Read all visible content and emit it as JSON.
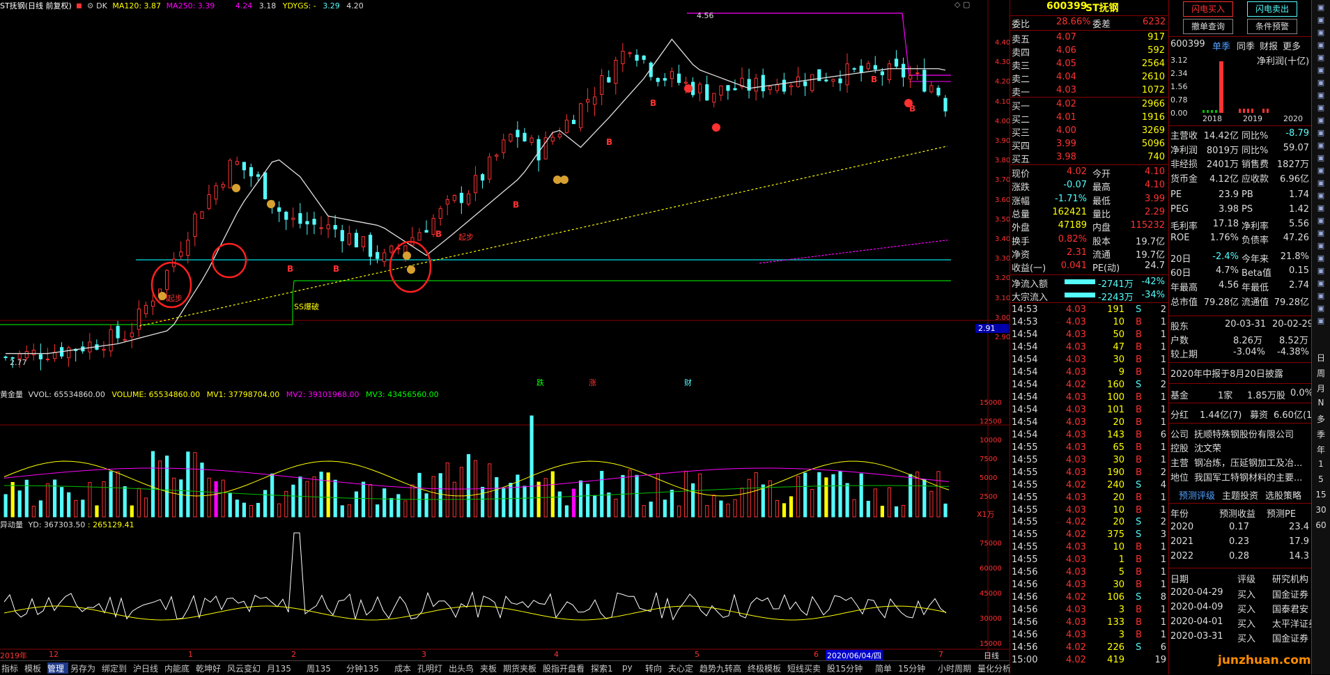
{
  "colors": {
    "up": "#ff3232",
    "down": "#54fcfc",
    "ma": "#e0e0e0",
    "yellow": "#ffff00",
    "magenta": "#ff00ff",
    "cyanline": "#00e0e0",
    "greenline": "#00d000"
  },
  "main_header": {
    "title": "ST抚钢(日线 前复权)",
    "dk": "DK",
    "ma120": "MA120: 3.87",
    "ma250": "MA250: 3.39",
    "v1": "4.24",
    "v2": "3.18",
    "ydygs": "YDYGS: -",
    "v3": "3.29",
    "v4": "4.20"
  },
  "price_axis": [
    "4.40",
    "4.30",
    "4.20",
    "4.10",
    "4.00",
    "3.90",
    "3.80",
    "3.70",
    "3.60",
    "3.50",
    "3.40",
    "3.30",
    "3.20",
    "3.10",
    "3.00",
    "2.90"
  ],
  "price_tag": "2.91",
  "annotations": {
    "high": "4.56",
    "low": "2.77",
    "qibu1": "起步",
    "qibu2": "起步",
    "baopo": "SS爆破",
    "die": "跌",
    "zhang": "涨",
    "cai": "财",
    "b": "B"
  },
  "vol_header": {
    "name": "黄金量",
    "vvol": "VVOL: 65534860.00",
    "volume": "VOLUME: 65534860.00",
    "mv1": "MV1: 37798704.00",
    "mv2": "MV2: 39101968.00",
    "mv3": "MV3: 43456560.00"
  },
  "vol_axis": [
    "15000",
    "12500",
    "10000",
    "7500",
    "5000",
    "2500"
  ],
  "vol_unit": "X1万",
  "yd_header": {
    "name": "异动量",
    "yd": "YD: 367303.50",
    "v2": ": 265129.41"
  },
  "yd_axis": [
    "75000",
    "60000",
    "45000",
    "30000",
    "15000"
  ],
  "date_axis": {
    "left": "2019年",
    "m12": "12",
    "m1": "1",
    "m2": "2",
    "m3": "3",
    "m4": "4",
    "m5": "5",
    "m6": "6",
    "cursor_date": "2020/06/04/四",
    "m7": "7",
    "period": "日线"
  },
  "bottom_tabs": [
    "指标",
    "模板",
    "管理",
    "另存为",
    "绑定到",
    "沪日线",
    "内能底",
    "乾坤好",
    "风云变幻",
    "月135",
    "周135",
    "分钟135",
    "成本",
    "孔明灯",
    "出头鸟",
    "夹板",
    "期货夹板",
    "股指开盘看",
    "探索1",
    "py",
    "转向",
    "夫心定",
    "趋势九转高",
    "终极模板",
    "短线买卖",
    "股15分钟",
    "简单",
    "15分钟",
    "小时周期",
    "量化分析"
  ],
  "quote": {
    "code": "600399",
    "name": "ST抚钢",
    "weibi_label": "委比",
    "weibi": "28.66%",
    "weicha_label": "委差",
    "weicha": "6232",
    "sells": [
      {
        "label": "卖五",
        "price": "4.07",
        "vol": "917"
      },
      {
        "label": "卖四",
        "price": "4.06",
        "vol": "592"
      },
      {
        "label": "卖三",
        "price": "4.05",
        "vol": "2564"
      },
      {
        "label": "卖二",
        "price": "4.04",
        "vol": "2610"
      },
      {
        "label": "卖一",
        "price": "4.03",
        "vol": "1072"
      }
    ],
    "buys": [
      {
        "label": "买一",
        "price": "4.02",
        "vol": "2966"
      },
      {
        "label": "买二",
        "price": "4.01",
        "vol": "1916"
      },
      {
        "label": "买三",
        "price": "4.00",
        "vol": "3269"
      },
      {
        "label": "买四",
        "price": "3.99",
        "vol": "5096"
      },
      {
        "label": "买五",
        "price": "3.98",
        "vol": "740"
      }
    ],
    "stats": [
      {
        "l1": "现价",
        "v1": "4.02",
        "l2": "今开",
        "v2": "4.10"
      },
      {
        "l1": "涨跌",
        "v1": "-0.07",
        "l2": "最高",
        "v2": "4.10"
      },
      {
        "l1": "涨幅",
        "v1": "-1.71%",
        "l2": "最低",
        "v2": "3.99"
      },
      {
        "l1": "总量",
        "v1": "162421",
        "l2": "量比",
        "v2": "2.29"
      },
      {
        "l1": "外盘",
        "v1": "47189",
        "l2": "内盘",
        "v2": "115232"
      },
      {
        "l1": "换手",
        "v1": "0.82%",
        "l2": "股本",
        "v2": "19.7亿"
      },
      {
        "l1": "净资",
        "v1": "2.31",
        "l2": "流通",
        "v2": "19.7亿"
      },
      {
        "l1": "收益(一)",
        "v1": "0.041",
        "l2": "PE(动)",
        "v2": "24.7"
      }
    ],
    "flows": [
      {
        "label": "净流入额",
        "value": "-2741万",
        "pct": "-42%"
      },
      {
        "label": "大宗流入",
        "value": "-2243万",
        "pct": "-34%"
      }
    ],
    "ticks": [
      [
        "14:53",
        "4.03",
        "191",
        "S",
        "2"
      ],
      [
        "14:53",
        "4.03",
        "10",
        "B",
        "1"
      ],
      [
        "14:54",
        "4.03",
        "50",
        "B",
        "1"
      ],
      [
        "14:54",
        "4.03",
        "47",
        "B",
        "1"
      ],
      [
        "14:54",
        "4.03",
        "30",
        "B",
        "1"
      ],
      [
        "14:54",
        "4.03",
        "9",
        "B",
        "1"
      ],
      [
        "14:54",
        "4.02",
        "160",
        "S",
        "2"
      ],
      [
        "14:54",
        "4.03",
        "100",
        "B",
        "1"
      ],
      [
        "14:54",
        "4.03",
        "101",
        "B",
        "1"
      ],
      [
        "14:54",
        "4.03",
        "20",
        "B",
        "1"
      ],
      [
        "14:54",
        "4.03",
        "143",
        "B",
        "6"
      ],
      [
        "14:55",
        "4.03",
        "65",
        "B",
        "1"
      ],
      [
        "14:55",
        "4.03",
        "30",
        "B",
        "1"
      ],
      [
        "14:55",
        "4.03",
        "190",
        "B",
        "2"
      ],
      [
        "14:55",
        "4.02",
        "240",
        "S",
        "4"
      ],
      [
        "14:55",
        "4.03",
        "20",
        "B",
        "1"
      ],
      [
        "14:55",
        "4.03",
        "10",
        "B",
        "1"
      ],
      [
        "14:55",
        "4.02",
        "20",
        "S",
        "2"
      ],
      [
        "14:55",
        "4.02",
        "375",
        "S",
        "3"
      ],
      [
        "14:55",
        "4.03",
        "10",
        "B",
        "1"
      ],
      [
        "14:55",
        "4.03",
        "1",
        "B",
        "1"
      ],
      [
        "14:56",
        "4.03",
        "5",
        "B",
        "1"
      ],
      [
        "14:56",
        "4.03",
        "30",
        "B",
        "1"
      ],
      [
        "14:56",
        "4.02",
        "106",
        "S",
        "8"
      ],
      [
        "14:56",
        "4.03",
        "3",
        "B",
        "1"
      ],
      [
        "14:56",
        "4.03",
        "133",
        "B",
        "1"
      ],
      [
        "14:56",
        "4.03",
        "3",
        "B",
        "1"
      ],
      [
        "14:56",
        "4.02",
        "226",
        "S",
        "6"
      ],
      [
        "15:00",
        "4.02",
        "419",
        "",
        "19"
      ]
    ]
  },
  "f10": {
    "btn_buy": "闪电买入",
    "btn_sell": "闪电卖出",
    "btn_cancel": "撤单查询",
    "btn_cond": "条件预警",
    "code": "600399",
    "tab1": "单季",
    "tab2": "同季",
    "tab3": "财报",
    "tab4": "更多",
    "chart_title": "净利润(十亿)",
    "chart_data": {
      "type": "bar",
      "categories": [
        "2018",
        "2019",
        "2020"
      ],
      "yticks": [
        "3.12",
        "2.34",
        "1.56",
        "0.78",
        "0.00"
      ]
    },
    "fin": [
      {
        "l1": "主营收",
        "v1": "14.42亿",
        "l2": "同比%",
        "v2": "-8.79"
      },
      {
        "l1": "净利润",
        "v1": "8019万",
        "l2": "同比%",
        "v2": "59.07"
      },
      {
        "l1": "非经损",
        "v1": "2401万",
        "l2": "销售费",
        "v2": "1827万"
      },
      {
        "l1": "货币金",
        "v1": "4.12亿",
        "l2": "应收款",
        "v2": "6.96亿"
      },
      {
        "l1": "PE",
        "v1": "23.9",
        "l2": "PB",
        "v2": "1.74"
      },
      {
        "l1": "PEG",
        "v1": "3.98",
        "l2": "PS",
        "v2": "1.42"
      },
      {
        "l1": "毛利率",
        "v1": "17.18",
        "l2": "净利率",
        "v2": "5.56"
      },
      {
        "l1": "ROE",
        "v1": "1.76%",
        "l2": "负债率",
        "v2": "47.26"
      },
      {
        "l1": "20日",
        "v1": "-2.4%",
        "l2": "今年来",
        "v2": "21.8%"
      },
      {
        "l1": "60日",
        "v1": "4.7%",
        "l2": "Beta值",
        "v2": "0.15"
      },
      {
        "l1": "年最高",
        "v1": "4.56",
        "l2": "年最低",
        "v2": "2.74"
      },
      {
        "l1": "总市值",
        "v1": "79.28亿",
        "l2": "流通值",
        "v2": "79.28亿"
      }
    ],
    "holders_label": "股东",
    "holders_d1": "20-03-31",
    "holders_d2": "20-02-29",
    "hushu_label": "户数",
    "hushu_v1": "8.26万",
    "hushu_v2": "8.52万",
    "jsq_label": "较上期",
    "jsq_v1": "-3.04%",
    "jsq_v2": "-4.38%",
    "report_note": "2020年中报于8月20日披露",
    "fund_label": "基金",
    "fund_count": "1家",
    "fund_hold": "1.85万股",
    "fund_pct": "0.0%",
    "div_label": "分红",
    "div_v": "1.44亿(7)",
    "raise_label": "募资",
    "raise_v": "6.60亿(1)",
    "company_label": "公司",
    "company": "抚顺特殊钢股份有限公司",
    "ctrl_label": "控股",
    "ctrl": "沈文荣",
    "main_label": "主营",
    "main": "钢冶炼，压延钢加工及冶...",
    "pos_label": "地位",
    "pos": "我国军工特钢材料的主要...",
    "tab_a": "预测评级",
    "tab_b": "主题投资",
    "tab_c": "选股策略",
    "fc_headers": [
      "年份",
      "预测收益",
      "预测PE"
    ],
    "forecast": [
      [
        "2020",
        "0.17",
        "23.4"
      ],
      [
        "2021",
        "0.23",
        "17.9"
      ],
      [
        "2022",
        "0.28",
        "14.3"
      ]
    ],
    "rt_headers": [
      "日期",
      "评级",
      "研究机构"
    ],
    "ratings": [
      [
        "2020-04-29",
        "买入",
        "国金证券"
      ],
      [
        "2020-04-09",
        "买入",
        "国泰君安"
      ],
      [
        "2020-04-01",
        "买入",
        "太平洋证券"
      ],
      [
        "2020-03-31",
        "买入",
        "国金证券"
      ]
    ],
    "watermark": "junzhuan.com"
  },
  "sidebar": [
    "日",
    "周",
    "月",
    "N",
    "多",
    "季",
    "年",
    "1",
    "5",
    "15",
    "30",
    "60"
  ]
}
